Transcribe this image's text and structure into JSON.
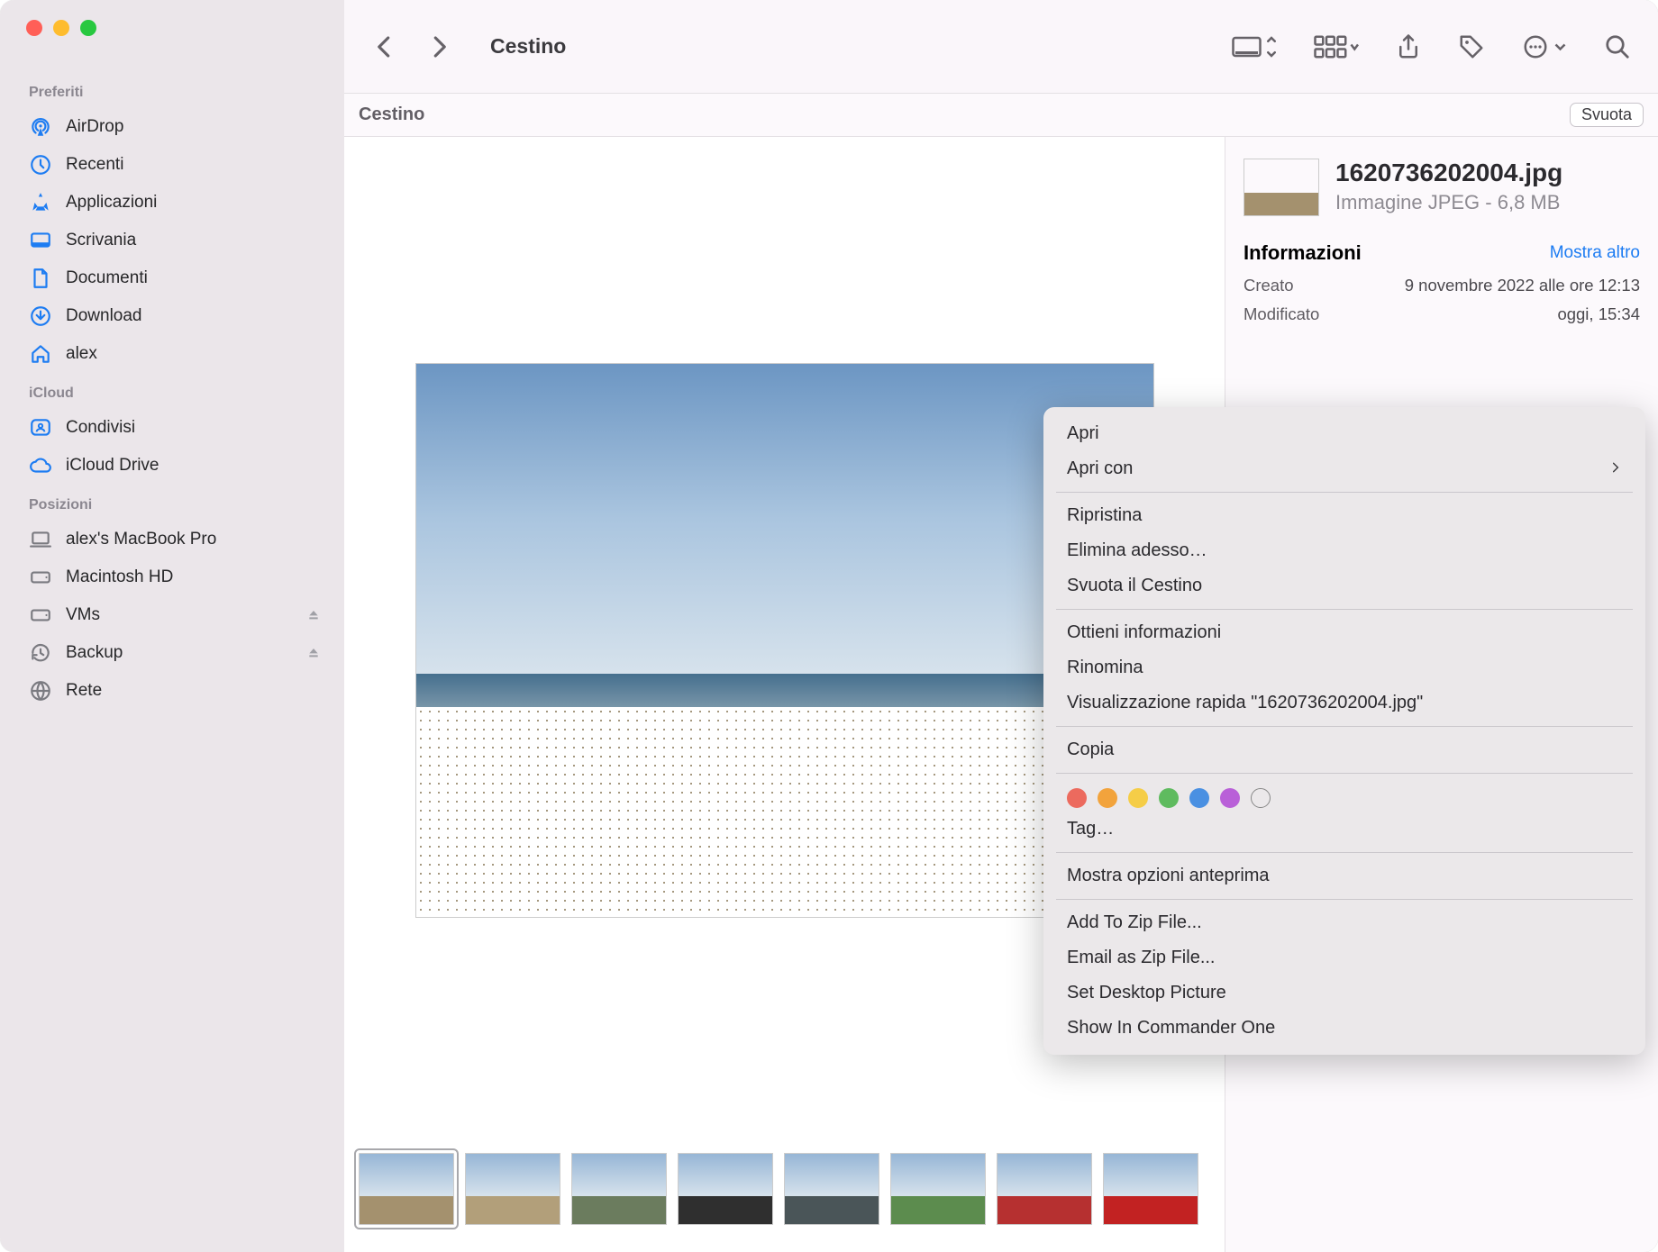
{
  "window_title": "Cestino",
  "sidebar": {
    "sections": [
      {
        "label": "Preferiti",
        "items": [
          {
            "icon": "airdrop",
            "label": "AirDrop"
          },
          {
            "icon": "clock",
            "label": "Recenti"
          },
          {
            "icon": "apps",
            "label": "Applicazioni"
          },
          {
            "icon": "desktop",
            "label": "Scrivania"
          },
          {
            "icon": "doc",
            "label": "Documenti"
          },
          {
            "icon": "download",
            "label": "Download"
          },
          {
            "icon": "home",
            "label": "alex"
          }
        ]
      },
      {
        "label": "iCloud",
        "items": [
          {
            "icon": "shared",
            "label": "Condivisi"
          },
          {
            "icon": "cloud",
            "label": "iCloud Drive"
          }
        ]
      },
      {
        "label": "Posizioni",
        "items": [
          {
            "icon": "laptop",
            "label": "alex's MacBook Pro",
            "gray": true
          },
          {
            "icon": "hdd",
            "label": "Macintosh HD",
            "gray": true
          },
          {
            "icon": "hdd",
            "label": "VMs",
            "gray": true,
            "eject": true
          },
          {
            "icon": "timemachine",
            "label": "Backup",
            "gray": true,
            "eject": true
          },
          {
            "icon": "network",
            "label": "Rete",
            "gray": true
          }
        ]
      }
    ]
  },
  "pathbar": {
    "location": "Cestino",
    "empty_button": "Svuota"
  },
  "selected_file": {
    "name": "1620736202004.jpg",
    "kind_size": "Immagine JPEG - 6,8 MB"
  },
  "info": {
    "section_title": "Informazioni",
    "show_more": "Mostra altro",
    "rows": [
      {
        "label": "Creato",
        "value": "9 novembre 2022 alle ore 12:13"
      },
      {
        "label": "Modificato",
        "value": "oggi, 15:34"
      }
    ]
  },
  "context_menu": {
    "group1": [
      "Apri",
      "Apri con"
    ],
    "group2": [
      "Ripristina",
      "Elimina adesso…",
      "Svuota il Cestino"
    ],
    "group3": [
      "Ottieni informazioni",
      "Rinomina",
      "Visualizzazione rapida \"1620736202004.jpg\""
    ],
    "group4": [
      "Copia"
    ],
    "tag_label": "Tag…",
    "tag_colors": [
      "#ec6a5e",
      "#f2a33c",
      "#f5cd47",
      "#5fbb5f",
      "#4a90e2",
      "#b960d8",
      "transparent"
    ],
    "group5": [
      "Mostra opzioni anteprima"
    ],
    "group6": [
      "Add To Zip File...",
      "Email as Zip File...",
      "Set Desktop Picture",
      "Show In Commander One"
    ]
  },
  "thumbs": [
    {
      "ground": "#a4916e",
      "sel": true
    },
    {
      "ground": "#b29f7a"
    },
    {
      "ground": "#6b7c5e"
    },
    {
      "ground": "#2f2f2f"
    },
    {
      "ground": "#4a5558"
    },
    {
      "ground": "#5c8c4e"
    },
    {
      "ground": "#b63030"
    },
    {
      "ground": "#c22222"
    }
  ]
}
